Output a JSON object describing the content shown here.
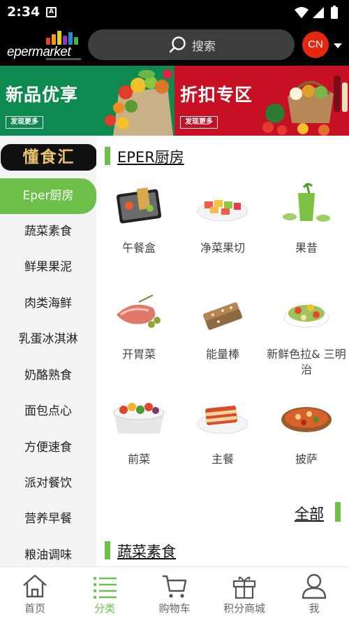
{
  "status_bar": {
    "time": "2:34",
    "notification_glyph": "A"
  },
  "header": {
    "logo_text": "epermarket",
    "search_placeholder": "搜索",
    "lang_badge": "CN"
  },
  "banners": [
    {
      "title": "新品优享",
      "button": "发现更多",
      "color": "#0d8a4f"
    },
    {
      "title": "折扣专区",
      "button": "发现更多",
      "color": "#c81024"
    }
  ],
  "sidebar": {
    "brand": "懂食汇",
    "items": [
      {
        "label": "Eper厨房",
        "active": true
      },
      {
        "label": "蔬菜素食",
        "active": false
      },
      {
        "label": "鲜果果泥",
        "active": false
      },
      {
        "label": "肉类海鲜",
        "active": false
      },
      {
        "label": "乳蛋冰淇淋",
        "active": false
      },
      {
        "label": "奶酪熟食",
        "active": false
      },
      {
        "label": "面包点心",
        "active": false
      },
      {
        "label": "方便速食",
        "active": false
      },
      {
        "label": "派对餐饮",
        "active": false
      },
      {
        "label": "营养早餐",
        "active": false
      },
      {
        "label": "粮油调味",
        "active": false
      }
    ]
  },
  "content": {
    "section1_title": "EPER厨房",
    "tiles": [
      {
        "label": "午餐盒",
        "icon": "lunchbox-icon"
      },
      {
        "label": "净菜果切",
        "icon": "fruit-platter-icon"
      },
      {
        "label": "果昔",
        "icon": "smoothie-icon"
      },
      {
        "label": "开胃菜",
        "icon": "appetizer-icon"
      },
      {
        "label": "能量棒",
        "icon": "energy-bar-icon"
      },
      {
        "label": "新鲜色拉& 三明治",
        "icon": "salad-icon"
      },
      {
        "label": "前菜",
        "icon": "starter-icon"
      },
      {
        "label": "主餐",
        "icon": "main-course-icon"
      },
      {
        "label": "披萨",
        "icon": "pizza-icon"
      }
    ],
    "all_link": "全部",
    "section2_title": "蔬菜素食"
  },
  "bottom_nav": [
    {
      "label": "首页",
      "icon": "home-icon",
      "active": false
    },
    {
      "label": "分类",
      "icon": "category-list-icon",
      "active": true
    },
    {
      "label": "购物车",
      "icon": "cart-icon",
      "active": false
    },
    {
      "label": "积分商城",
      "icon": "gift-icon",
      "active": false
    },
    {
      "label": "我",
      "icon": "profile-icon",
      "active": false
    }
  ],
  "colors": {
    "accent_green": "#6cc04a",
    "lang_red": "#e4270f"
  }
}
